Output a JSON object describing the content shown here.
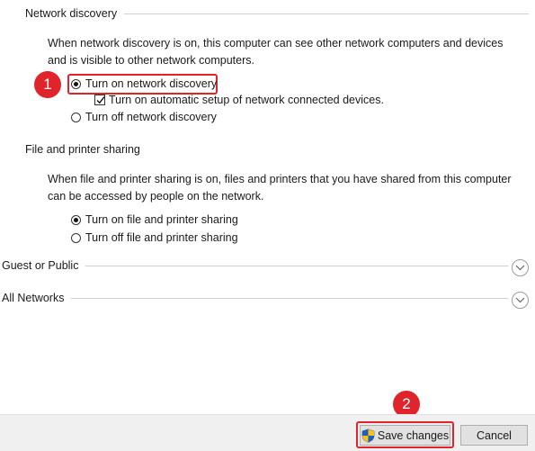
{
  "network_discovery": {
    "header": "Network discovery",
    "description": "When network discovery is on, this computer can see other network computers and devices and is visible to other network computers.",
    "option_on": "Turn on network discovery",
    "option_auto_setup": "Turn on automatic setup of network connected devices.",
    "option_off": "Turn off network discovery",
    "selected": "on",
    "auto_setup_checked": true
  },
  "file_printer_sharing": {
    "header": "File and printer sharing",
    "description": "When file and printer sharing is on, files and printers that you have shared from this computer can be accessed by people on the network.",
    "option_on": "Turn on file and printer sharing",
    "option_off": "Turn off file and printer sharing",
    "selected": "on"
  },
  "collapsed_sections": [
    {
      "label": "Guest or Public"
    },
    {
      "label": "All Networks"
    }
  ],
  "annotations": {
    "step1": "1",
    "step2": "2",
    "highlight_color": "#e0242b"
  },
  "footer": {
    "save_label": "Save changes",
    "cancel_label": "Cancel"
  }
}
